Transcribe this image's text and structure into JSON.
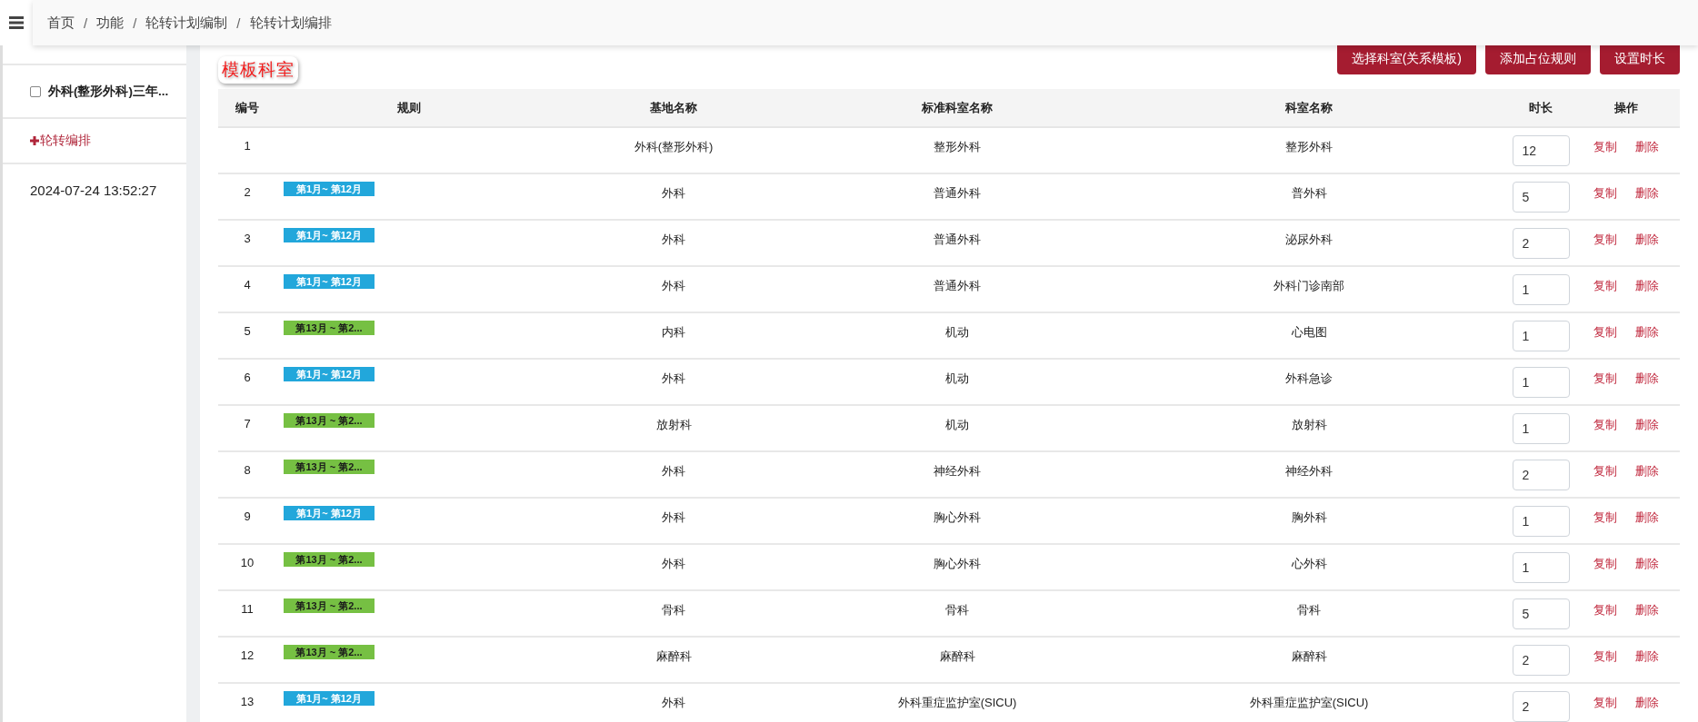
{
  "breadcrumb": [
    {
      "label": "首页"
    },
    {
      "separator": "/",
      "label": "功能"
    },
    {
      "separator": "/",
      "label": "轮转计划编制"
    },
    {
      "separator": "/",
      "label": "轮转计划编排"
    }
  ],
  "sidebar": {
    "plan": {
      "label": "外科(整形外科)三年...",
      "checked": false
    },
    "add_link": "轮转编排",
    "timestamp": "2024-07-24 13:52:27"
  },
  "section_title": "模板科室",
  "buttons": [
    "选择科室(关系模板)",
    "添加占位规则",
    "设置时长"
  ],
  "table": {
    "columns": [
      "编号",
      "规则",
      "基地名称",
      "标准科室名称",
      "科室名称",
      "时长",
      "操作"
    ],
    "rows": [
      {
        "no": "1",
        "base": "外科(整形外科)",
        "standard": "整形外科",
        "dept": "整形外科",
        "duration": "12",
        "actions": [
          "复制",
          "删除"
        ]
      },
      {
        "no": "2",
        "rule": {
          "label": "第1月~ 第12月",
          "color": "#22a7db"
        },
        "base": "外科",
        "standard": "普通外科",
        "dept": "普外科",
        "duration": "5",
        "actions": [
          "复制",
          "删除"
        ]
      },
      {
        "no": "3",
        "rule": {
          "label": "第1月~ 第12月",
          "color": "#22a7db"
        },
        "base": "外科",
        "standard": "普通外科",
        "dept": "泌尿外科",
        "duration": "2",
        "actions": [
          "复制",
          "删除"
        ]
      },
      {
        "no": "4",
        "rule": {
          "label": "第1月~ 第12月",
          "color": "#22a7db"
        },
        "base": "外科",
        "standard": "普通外科",
        "dept": "外科门诊南部",
        "duration": "1",
        "actions": [
          "复制",
          "删除"
        ]
      },
      {
        "no": "5",
        "rule": {
          "label": "第13月 ~ 第2...",
          "color": "#76c043"
        },
        "base": "内科",
        "standard": "机动",
        "dept": "心电图",
        "duration": "1",
        "actions": [
          "复制",
          "删除"
        ]
      },
      {
        "no": "6",
        "rule": {
          "label": "第1月~ 第12月",
          "color": "#22a7db"
        },
        "base": "外科",
        "standard": "机动",
        "dept": "外科急诊",
        "duration": "1",
        "actions": [
          "复制",
          "删除"
        ]
      },
      {
        "no": "7",
        "rule": {
          "label": "第13月 ~ 第2...",
          "color": "#76c043"
        },
        "base": "放射科",
        "standard": "机动",
        "dept": "放射科",
        "duration": "1",
        "actions": [
          "复制",
          "删除"
        ]
      },
      {
        "no": "8",
        "rule": {
          "label": "第13月 ~ 第2...",
          "color": "#76c043"
        },
        "base": "外科",
        "standard": "神经外科",
        "dept": "神经外科",
        "duration": "2",
        "actions": [
          "复制",
          "删除"
        ]
      },
      {
        "no": "9",
        "rule": {
          "label": "第1月~ 第12月",
          "color": "#22a7db"
        },
        "base": "外科",
        "standard": "胸心外科",
        "dept": "胸外科",
        "duration": "1",
        "actions": [
          "复制",
          "删除"
        ]
      },
      {
        "no": "10",
        "rule": {
          "label": "第13月 ~ 第2...",
          "color": "#76c043"
        },
        "base": "外科",
        "standard": "胸心外科",
        "dept": "心外科",
        "duration": "1",
        "actions": [
          "复制",
          "删除"
        ]
      },
      {
        "no": "11",
        "rule": {
          "label": "第13月 ~ 第2...",
          "color": "#76c043"
        },
        "base": "骨科",
        "standard": "骨科",
        "dept": "骨科",
        "duration": "5",
        "actions": [
          "复制",
          "删除"
        ]
      },
      {
        "no": "12",
        "rule": {
          "label": "第13月 ~ 第2...",
          "color": "#76c043"
        },
        "base": "麻醉科",
        "standard": "麻醉科",
        "dept": "麻醉科",
        "duration": "2",
        "actions": [
          "复制",
          "删除"
        ]
      },
      {
        "no": "13",
        "rule": {
          "label": "第1月~ 第12月",
          "color": "#22a7db"
        },
        "base": "外科",
        "standard": "外科重症监护室(SICU)",
        "dept": "外科重症监护室(SICU)",
        "duration": "2",
        "actions": [
          "复制",
          "删除"
        ]
      }
    ]
  }
}
